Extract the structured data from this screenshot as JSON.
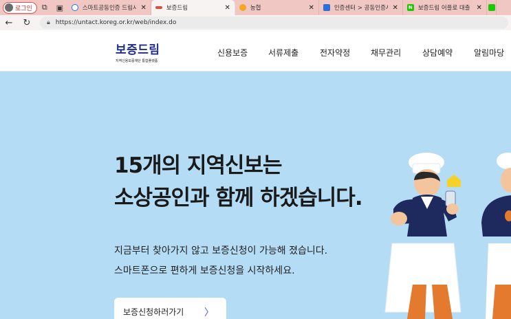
{
  "browser": {
    "profile_label": "로그인",
    "tabs": [
      {
        "title": "스마트공동인증 드림시",
        "icon": "search-icon",
        "color": "#1a73e8"
      },
      {
        "title": "보증드림",
        "icon": "site-icon",
        "color": "#e04b3a",
        "active": true
      },
      {
        "title": "농협",
        "icon": "nh-icon",
        "color": "#f5a623"
      },
      {
        "title": "인증센터 > 공동인증서",
        "icon": "cert-icon",
        "color": "#2c6fd6"
      },
      {
        "title": "보증드림 어플로 대출",
        "icon": "naver-icon",
        "color": "#1ec800"
      }
    ],
    "url": "https://untact.koreg.or.kr/web/index.do"
  },
  "header": {
    "logo_title": "보증드림",
    "logo_subtitle": "지역신용보증재단 통합플랫폼",
    "nav": [
      "신용보증",
      "서류제출",
      "전자약정",
      "채무관리",
      "상담예약",
      "알림마당"
    ]
  },
  "hero": {
    "headline_1": "15개의 지역신보는",
    "headline_2": "소상공인과 함께 하겠습니다.",
    "desc_1": "지금부터 찾아가지 않고 보증신청이 가능해 졌습니다.",
    "desc_2": "스마트폰으로 편하게 보증신청을 시작하세요.",
    "cta_label": "보증신청하러가기",
    "cta_arrow": "〉"
  },
  "colors": {
    "hero_bg": "#b5dcf5",
    "logo": "#1c2c8c",
    "tabbar": "#f1c7c4"
  }
}
